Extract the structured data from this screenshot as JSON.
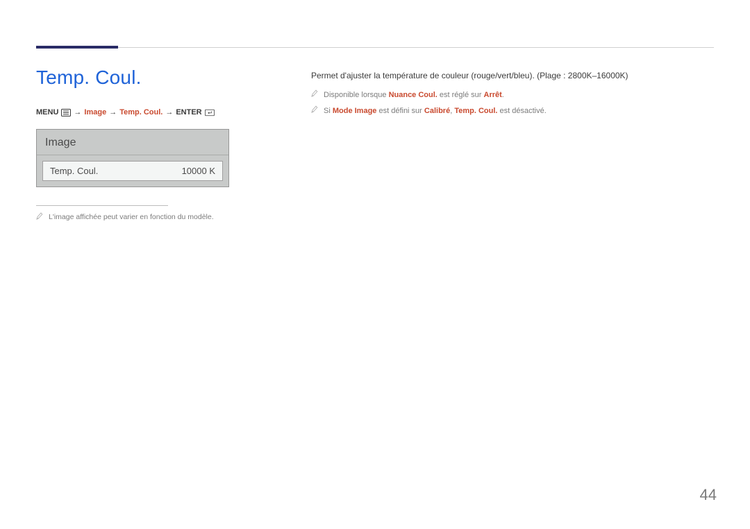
{
  "page": {
    "title": "Temp. Coul.",
    "number": "44"
  },
  "nav": {
    "menu": "MENU",
    "arrow": "→",
    "image": "Image",
    "temp": "Temp. Coul.",
    "enter": "ENTER"
  },
  "panel": {
    "header": "Image",
    "row_label": "Temp. Coul.",
    "row_value": "10000 K"
  },
  "left_note": "L'image affichée peut varier en fonction du modèle.",
  "description": "Permet d'ajuster la température de couleur (rouge/vert/bleu). (Plage : 2800K–16000K)",
  "note1": {
    "pre": "Disponible lorsque ",
    "k1": "Nuance Coul.",
    "mid": " est réglé sur ",
    "k2": "Arrêt",
    "post": "."
  },
  "note2": {
    "pre": "Si ",
    "k1": "Mode Image",
    "mid1": " est défini sur ",
    "k2": "Calibré",
    "sep": ", ",
    "k3": "Temp. Coul.",
    "post": " est désactivé."
  }
}
